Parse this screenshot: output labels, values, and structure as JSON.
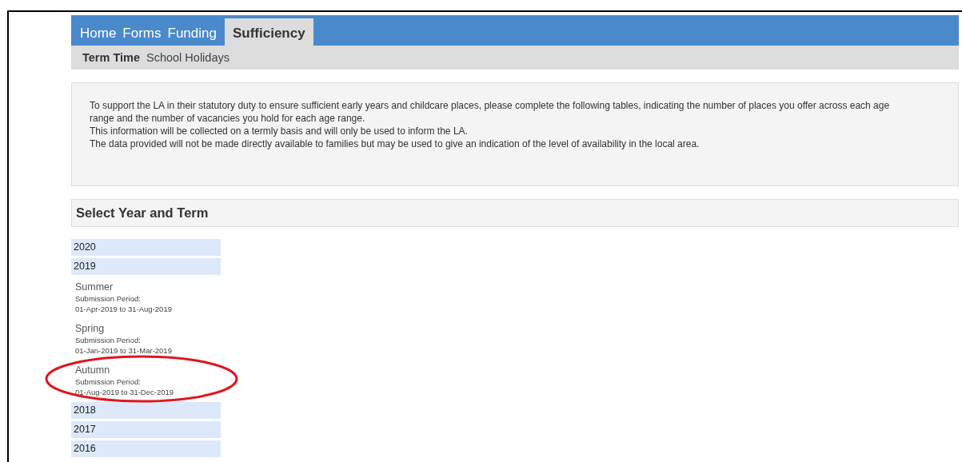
{
  "nav_tabs": [
    {
      "label": "Home",
      "selected": false
    },
    {
      "label": "Forms",
      "selected": false
    },
    {
      "label": "Funding",
      "selected": false
    },
    {
      "label": "Sufficiency",
      "selected": true
    }
  ],
  "sub_tabs": [
    {
      "label": "Term Time",
      "selected": true
    },
    {
      "label": "School Holidays",
      "selected": false
    }
  ],
  "info": {
    "lines": [
      "To support the LA in their statutory duty to ensure sufficient early years and childcare places, please complete the following tables, indicating the number of places you offer across each age range and the number of vacancies you hold for each age range.",
      "This information will be collected on a termly basis and will only be used to inform the LA.",
      "The data provided will not be made directly available to families but may be used to give an indication of the level of availability in the local area."
    ]
  },
  "section_title": "Select Year and Term",
  "years": [
    {
      "label": "2020"
    },
    {
      "label": "2019",
      "children": [
        {
          "term": "Summer",
          "period_label": "Submission Period:",
          "period": "01-Apr-2019 to 31-Aug-2019",
          "circled": false
        },
        {
          "term": "Spring",
          "period_label": "Submission Period:",
          "period": "01-Jan-2019 to 31-Mar-2019",
          "circled": false
        },
        {
          "term": "Autumn",
          "period_label": "Submission Period:",
          "period": "01-Aug-2019 to 31-Dec-2019",
          "circled": true
        }
      ]
    },
    {
      "label": "2018"
    },
    {
      "label": "2017"
    },
    {
      "label": "2016"
    }
  ]
}
